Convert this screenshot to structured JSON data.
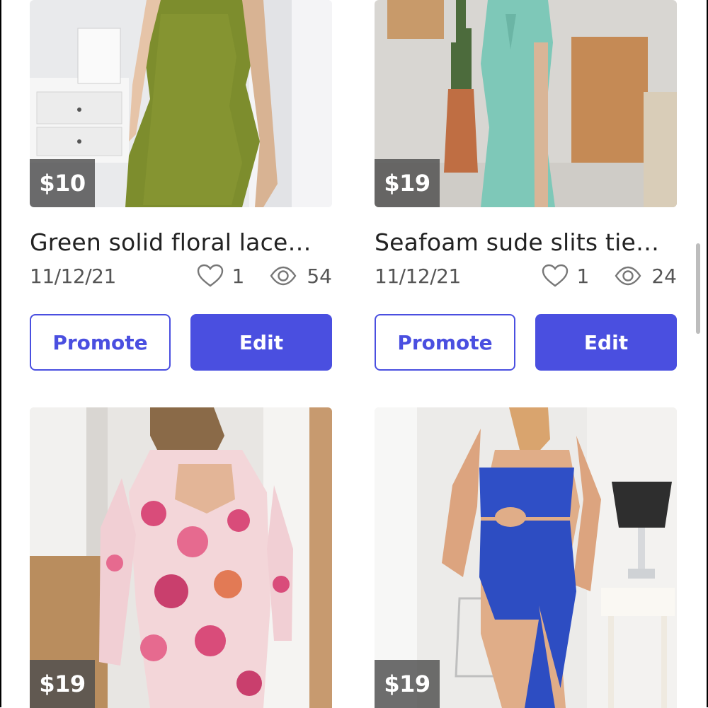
{
  "listings": [
    {
      "price": "$10",
      "title": "Green solid floral lace…",
      "date": "11/12/21",
      "likes": "1",
      "views": "54",
      "promote_label": "Promote",
      "edit_label": "Edit"
    },
    {
      "price": "$19",
      "title": "Seafoam sude slits tie…",
      "date": "11/12/21",
      "likes": "1",
      "views": "24",
      "promote_label": "Promote",
      "edit_label": "Edit"
    },
    {
      "price": "$19"
    },
    {
      "price": "$19"
    }
  ],
  "colors": {
    "accent": "#4a4fe0",
    "price_tag_bg": "#4e4e4e"
  },
  "icons": {
    "likes": "heart-icon",
    "views": "eye-icon"
  }
}
